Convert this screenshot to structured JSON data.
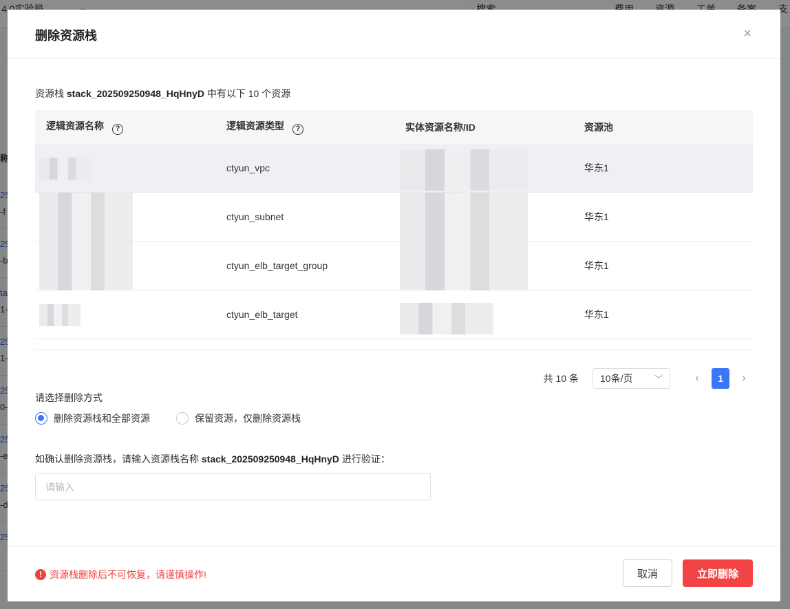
{
  "background": {
    "env": "4.0实验局",
    "search_placeholder": "搜索",
    "nav": [
      "费用",
      "资源",
      "工单",
      "备案",
      "支"
    ],
    "col_header": "称",
    "rows": [
      [
        "25",
        "-f"
      ],
      [
        "25",
        "-b"
      ],
      [
        "ta",
        "1-"
      ],
      [
        "25",
        "1-"
      ],
      [
        "25",
        "0-"
      ],
      [
        "25",
        "-e"
      ],
      [
        "25",
        "-d"
      ],
      [
        "25",
        ""
      ]
    ]
  },
  "modal": {
    "title": "删除资源栈",
    "close_icon": "×",
    "intro_prefix": "资源栈 ",
    "stack_name": "stack_202509250948_HqHnyD",
    "intro_suffix": " 中有以下 10 个资源",
    "columns": [
      "逻辑资源名称",
      "逻辑资源类型",
      "实体资源名称/ID",
      "资源池"
    ],
    "help_icon": "?",
    "rows": [
      {
        "type": "ctyun_vpc",
        "pool": "华东1"
      },
      {
        "type": "ctyun_subnet",
        "pool": "华东1"
      },
      {
        "type": "ctyun_elb_target_group",
        "pool": "华东1"
      },
      {
        "type": "ctyun_elb_target",
        "pool": "华东1"
      }
    ],
    "pagination": {
      "total": "共 10 条",
      "page_size": "10条/页",
      "current_page": "1"
    },
    "delete_mode_label": "请选择删除方式",
    "modes": [
      "删除资源栈和全部资源",
      "保留资源，仅删除资源栈"
    ],
    "selected_mode": 0,
    "confirm_prefix": "如确认删除资源栈，请输入资源栈名称 ",
    "confirm_suffix": " 进行验证：",
    "input_placeholder": "请输入",
    "input_value": "",
    "warning": "资源栈删除后不可恢复，请谨慎操作!",
    "cancel_label": "取消",
    "delete_label": "立即删除"
  }
}
